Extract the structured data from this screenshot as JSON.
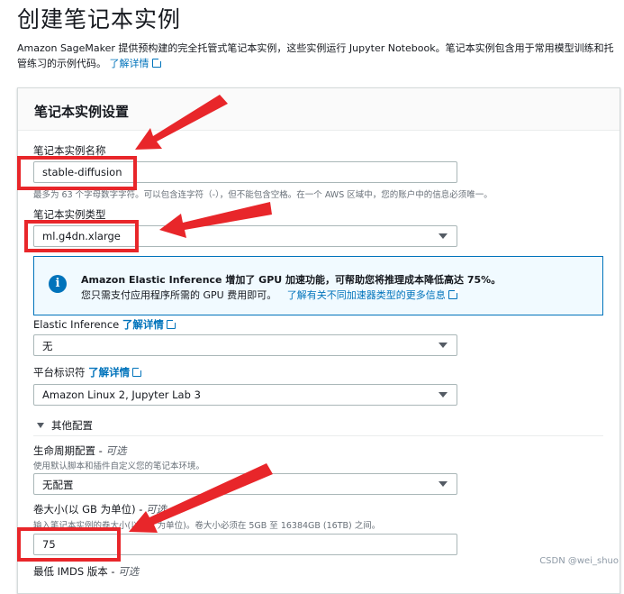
{
  "page": {
    "title": "创建笔记本实例",
    "intro_text": "Amazon SageMaker 提供预构建的完全托管式笔记本实例，这些实例运行 Jupyter Notebook。笔记本实例包含用于常用模型训练和托管练习的示例代码。",
    "intro_link": "了解详情"
  },
  "panel": {
    "title": "笔记本实例设置",
    "name_label": "笔记本实例名称",
    "name_value": "stable-diffusion",
    "name_hint": "最多为 63 个字母数字字符。可以包含连字符（-），但不能包含空格。在一个 AWS 区域中，您的账户中的信息必须唯一。",
    "type_label": "笔记本实例类型",
    "type_value": "ml.g4dn.xlarge",
    "info": {
      "line1": "Amazon Elastic Inference 增加了 GPU 加速功能，可帮助您将推理成本降低高达 75%。",
      "line2": "您只需支付应用程序所需的 GPU 费用即可。",
      "link": "了解有关不同加速器类型的更多信息",
      "icon": "info-icon"
    },
    "ei_label": "Elastic Inference",
    "ei_link": "了解详情",
    "ei_value": "无",
    "platform_label": "平台标识符",
    "platform_link": "了解详情",
    "platform_value": "Amazon Linux 2, Jupyter Lab 3",
    "other_config": "其他配置",
    "lifecycle_label": "生命周期配置",
    "optional": "可选",
    "lifecycle_hint": "使用默认脚本和插件自定义您的笔记本环境。",
    "lifecycle_value": "无配置",
    "volume_label": "卷大小(以 GB 为单位)",
    "volume_hint": "输入笔记本实例的卷大小(以 GB 为单位)。卷大小必须在 5GB 至 16384GB (16TB) 之间。",
    "volume_value": "75",
    "imds_label": "最低 IMDS 版本"
  },
  "watermark": "CSDN @wei_shuo",
  "colors": {
    "accent": "#0073bb",
    "highlight": "#e8262a"
  }
}
